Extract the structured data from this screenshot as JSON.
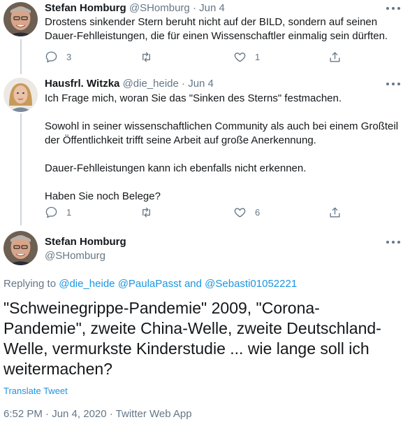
{
  "tweet1": {
    "name": "Stefan Homburg",
    "handle": "@SHomburg",
    "separator": "·",
    "date": "Jun 4",
    "text": "Drostens sinkender Stern beruht nicht auf der BILD, sondern auf seinen Dauer-Fehlleistungen, die für einen Wissenschaftler einmalig sein dürften.",
    "replies": "3",
    "likes": "1"
  },
  "tweet2": {
    "name": "Hausfrl. Witzka",
    "handle": "@die_heide",
    "separator": "·",
    "date": "Jun 4",
    "paragraphs": [
      "Ich Frage mich, woran Sie das \"Sinken des Sterns\" festmachen.",
      "Sowohl in seiner wissenschaftlichen Community als auch bei einem Großteil der Öffentlichkeit trifft seine Arbeit auf große Anerkennung.",
      "Dauer-Fehlleistungen kann ich ebenfalls nicht erkennen.",
      "Haben Sie noch Belege?"
    ],
    "replies": "1",
    "likes": "6"
  },
  "main": {
    "name": "Stefan Homburg",
    "handle": "@SHomburg",
    "replying_prefix": "Replying to",
    "mention1": "@die_heide",
    "mention2": "@PaulaPasst",
    "and": "and",
    "mention3": "@Sebasti01052221",
    "text": "\"Schweinegrippe-Pandemie\" 2009, \"Corona-Pandemie\", zweite China-Welle, zweite Deutschland-Welle, vermurkste Kinderstudie ... wie lange soll ich weitermachen?",
    "translate": "Translate Tweet",
    "timestamp": "6:52 PM · Jun 4, 2020 · Twitter Web App"
  },
  "colors": {
    "accent": "#1b95e0",
    "secondary_text": "#657786",
    "primary_text": "#14171a",
    "thread_line": "#ccd6dd"
  },
  "icons": {
    "reply": "reply-icon",
    "retweet": "retweet-icon",
    "like": "heart-icon",
    "share": "share-icon",
    "more": "more-icon"
  }
}
